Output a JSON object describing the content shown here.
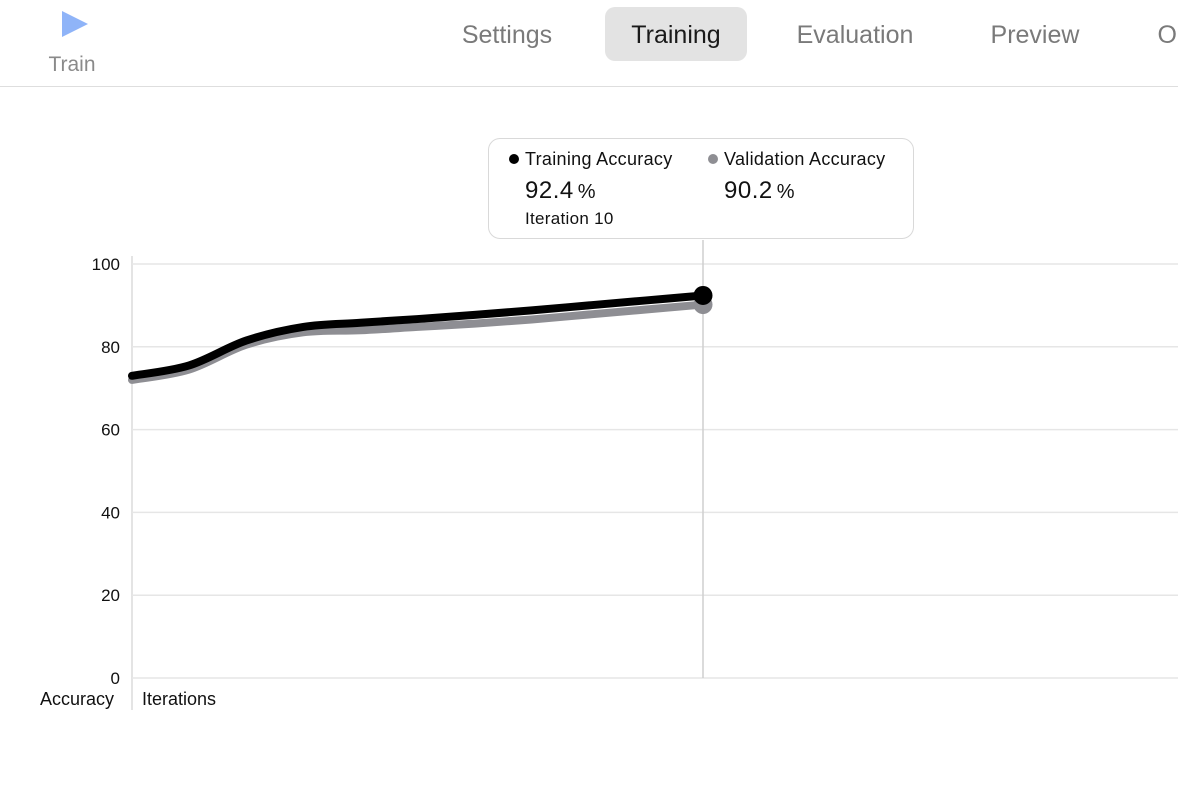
{
  "toolbar": {
    "train_label": "Train",
    "accent_color": "#8fb4f8",
    "tabs": [
      {
        "label": "Settings",
        "active": false
      },
      {
        "label": "Training",
        "active": true
      },
      {
        "label": "Evaluation",
        "active": false
      },
      {
        "label": "Preview",
        "active": false
      },
      {
        "label": "Output",
        "active": false
      }
    ]
  },
  "tooltip": {
    "series": [
      {
        "name": "Training Accuracy",
        "value": "92.4",
        "unit": "%",
        "color": "#000000"
      },
      {
        "name": "Validation Accuracy",
        "value": "90.2",
        "unit": "%",
        "color": "#8e8e93"
      }
    ],
    "iteration_label": "Iteration 10"
  },
  "chart_data": {
    "type": "line",
    "ylabel": "Accuracy",
    "xlabel": "Iterations",
    "ylim": [
      0,
      100
    ],
    "xlim": [
      0,
      20
    ],
    "yticks": [
      0,
      20,
      40,
      60,
      80,
      100
    ],
    "grid": true,
    "x": [
      0,
      1,
      2,
      3,
      4,
      5,
      6,
      7,
      8,
      9,
      10
    ],
    "series": [
      {
        "name": "Training Accuracy",
        "color": "#000000",
        "values": [
          73,
          75.5,
          81.5,
          84.8,
          85.8,
          86.7,
          87.7,
          88.8,
          90.0,
          91.2,
          92.4
        ]
      },
      {
        "name": "Validation Accuracy",
        "color": "#8e8e93",
        "values": [
          72,
          74.5,
          80.5,
          83.5,
          84.0,
          84.8,
          85.6,
          86.6,
          87.8,
          89.0,
          90.2
        ]
      }
    ],
    "highlight_x": 10
  }
}
